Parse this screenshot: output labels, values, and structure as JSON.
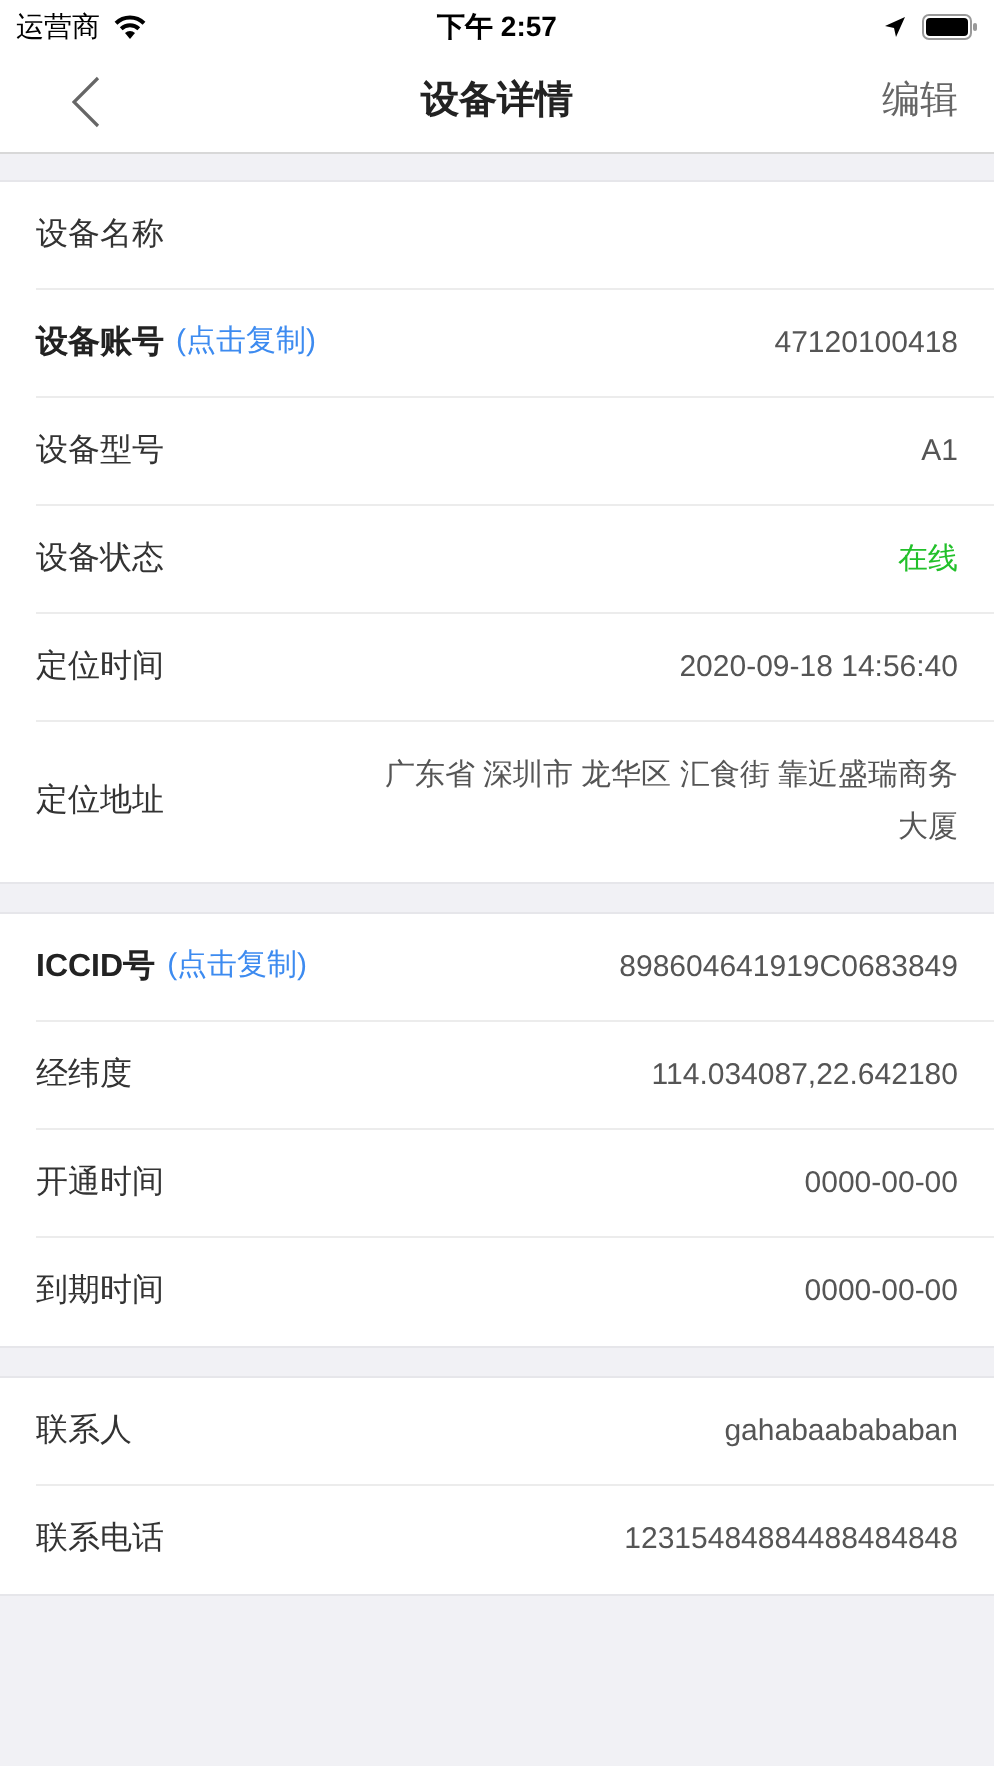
{
  "status_bar": {
    "carrier": "运营商",
    "time": "下午 2:57"
  },
  "nav": {
    "title": "设备详情",
    "action": "编辑"
  },
  "sections": [
    {
      "rows": [
        {
          "label": "设备名称"
        },
        {
          "label": "设备账号",
          "copy_link": "(点击复制)",
          "value": "47120100418",
          "kind": "plain"
        },
        {
          "label": "设备型号",
          "value": "A1",
          "kind": "plain"
        },
        {
          "label": "设备状态",
          "value": "在线",
          "kind": "status"
        },
        {
          "label": "定位时间",
          "value": "2020-09-18 14:56:40",
          "kind": "plain"
        },
        {
          "label": "定位地址",
          "value": "广东省 深圳市 龙华区 汇食街 靠近盛瑞商务大厦",
          "kind": "plain"
        }
      ]
    },
    {
      "rows": [
        {
          "label": "ICCID号",
          "copy_link": "(点击复制)",
          "value": "898604641919C0683849",
          "kind": "plain"
        },
        {
          "label": "经纬度",
          "value": "114.034087,22.642180",
          "kind": "plain"
        },
        {
          "label": "开通时间",
          "value": "0000-00-00",
          "kind": "plain"
        },
        {
          "label": "到期时间",
          "value": "0000-00-00",
          "kind": "plain"
        }
      ]
    },
    {
      "rows": [
        {
          "label": "联系人",
          "value": "gahabaabababan",
          "kind": "plain"
        },
        {
          "label": "联系电话",
          "value": "12315484884488484848",
          "kind": "plain"
        }
      ]
    }
  ]
}
